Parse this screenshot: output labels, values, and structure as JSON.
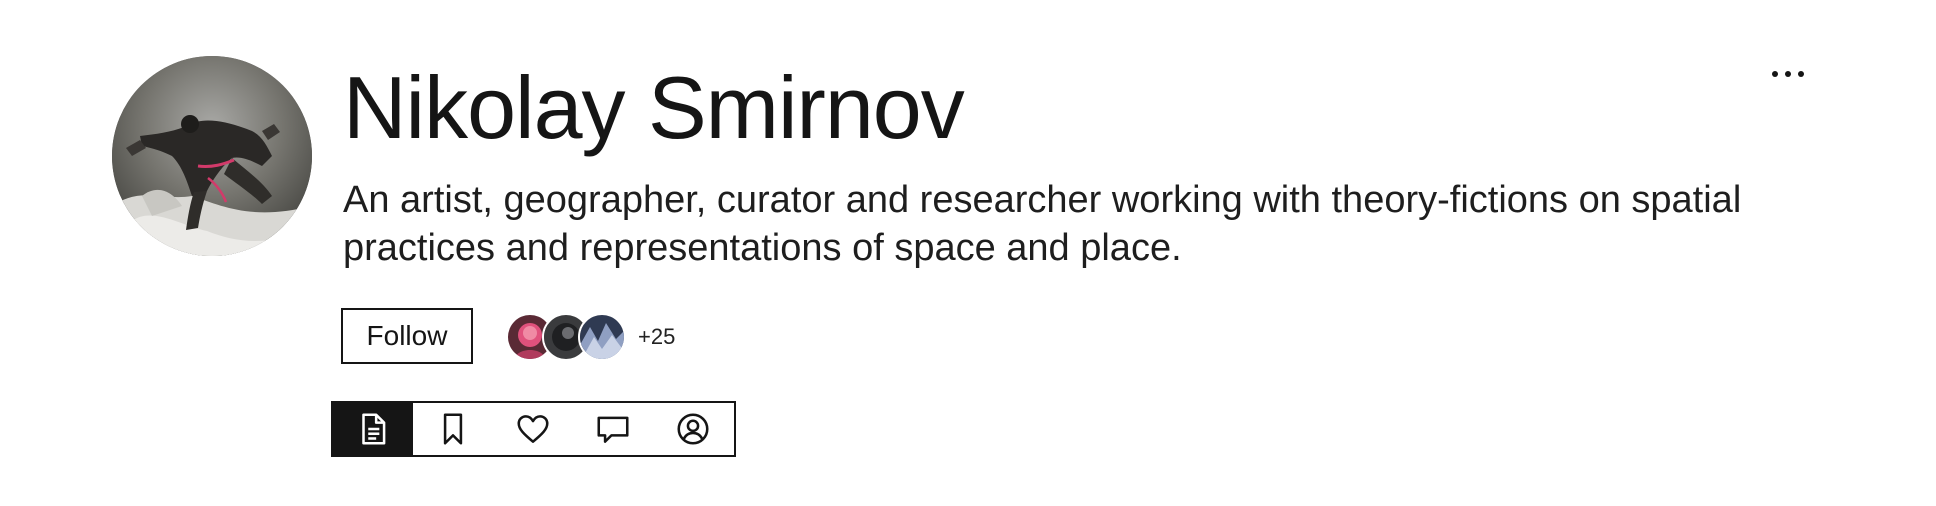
{
  "profile": {
    "name": "Nikolay Smirnov",
    "bio": "An artist, geographer, curator and researcher working with theory-fictions on spatial practices and representations of space and place."
  },
  "actions": {
    "follow_label": "Follow",
    "followers_extra": "+25",
    "more_icon": "more-horizontal-icon"
  },
  "tabs": [
    {
      "icon": "document-icon",
      "active": true
    },
    {
      "icon": "bookmark-icon",
      "active": false
    },
    {
      "icon": "heart-icon",
      "active": false
    },
    {
      "icon": "comment-icon",
      "active": false
    },
    {
      "icon": "user-circle-icon",
      "active": false
    }
  ],
  "colors": {
    "text": "#151515",
    "background": "#ffffff",
    "active_tab_bg": "#151515",
    "active_tab_icon": "#ffffff"
  }
}
